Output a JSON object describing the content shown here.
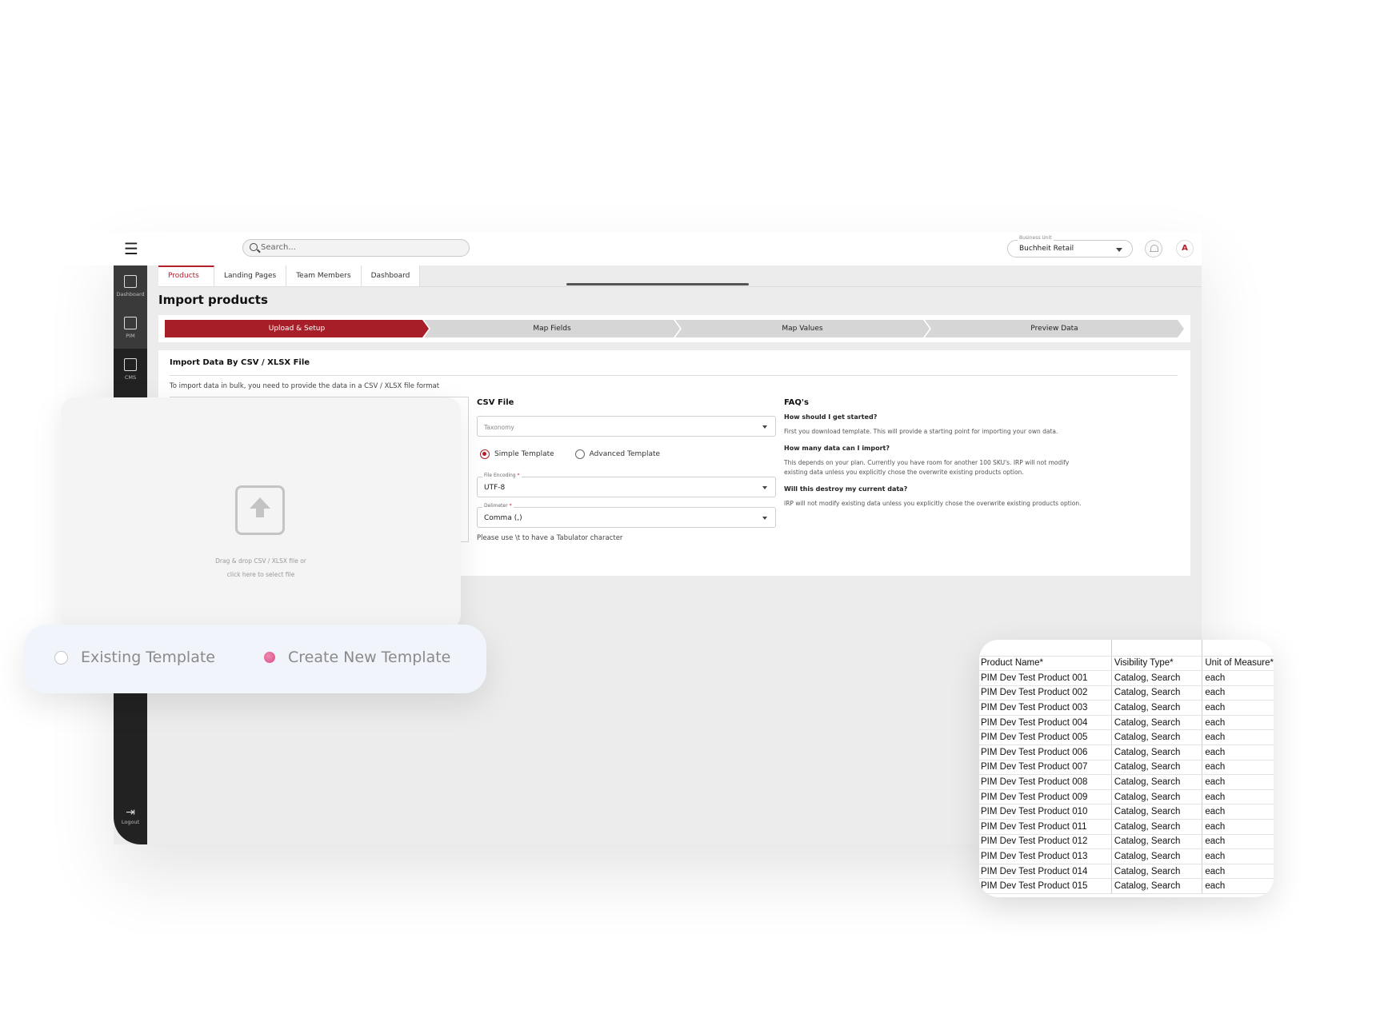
{
  "header": {
    "search_placeholder": "Search...",
    "business_unit_label": "Business Unit",
    "business_unit_value": "Buchheit Retail",
    "avatar_initial": "A"
  },
  "sidebar": {
    "items": [
      {
        "label": "Dashboard",
        "icon": "dashboard-icon"
      },
      {
        "label": "PIM",
        "icon": "pim-icon"
      },
      {
        "label": "CMS",
        "icon": "cms-icon"
      }
    ],
    "logout_label": "Logout"
  },
  "tabs": [
    "Products",
    "Landing Pages",
    "Team Members",
    "Dashboard"
  ],
  "page_title": "Import products",
  "steps": [
    "Upload & Setup",
    "Map Fields",
    "Map Values",
    "Preview Data"
  ],
  "import": {
    "title": "Import Data By CSV / XLSX File",
    "description": "To import data in bulk, you need to provide the data in a CSV / XLSX file format",
    "drop_line1": "Drag & drop CSV / XLSX file or",
    "drop_line2": "click here to select file"
  },
  "csv": {
    "title": "CSV File",
    "taxonomy_placeholder": "Taxonomy",
    "simple_template": "Simple Template",
    "advanced_template": "Advanced Template",
    "encoding_label": "File Encoding",
    "encoding_value": "UTF-8",
    "delimiter_label": "Delimeter",
    "delimiter_value": "Comma (,)",
    "required_mark": "*",
    "hint": "Please use \\t to have a Tabulator character"
  },
  "faq": {
    "title": "FAQ's",
    "items": [
      {
        "q": "How should I get started?",
        "a": "First you download template. This will provide a starting point for importing your own data."
      },
      {
        "q": "How many data can I import?",
        "a": "This depends on your plan. Currently you have room for another 100 SKU's. IRP will not modify existing data unless you explicitly chose the overwrite existing products option."
      },
      {
        "q": "Will this destroy my current data?",
        "a": "IRP will not modify existing data unless you explicitly chose the overwrite existing products option."
      }
    ]
  },
  "template_choice": {
    "existing": "Existing Template",
    "create_new": "Create New Template"
  },
  "sheet": {
    "headers": [
      "Product Name*",
      "Visibility Type*",
      "Unit of Measure*"
    ],
    "rows": [
      [
        "PIM Dev Test Product 001",
        "Catalog, Search",
        "each"
      ],
      [
        "PIM Dev Test Product 002",
        "Catalog, Search",
        "each"
      ],
      [
        "PIM Dev Test Product 003",
        "Catalog, Search",
        "each"
      ],
      [
        "PIM Dev Test Product 004",
        "Catalog, Search",
        "each"
      ],
      [
        "PIM Dev Test Product 005",
        "Catalog, Search",
        "each"
      ],
      [
        "PIM Dev Test Product 006",
        "Catalog, Search",
        "each"
      ],
      [
        "PIM Dev Test Product 007",
        "Catalog, Search",
        "each"
      ],
      [
        "PIM Dev Test Product 008",
        "Catalog, Search",
        "each"
      ],
      [
        "PIM Dev Test Product 009",
        "Catalog, Search",
        "each"
      ],
      [
        "PIM Dev Test Product 010",
        "Catalog, Search",
        "each"
      ],
      [
        "PIM Dev Test Product 011",
        "Catalog, Search",
        "each"
      ],
      [
        "PIM Dev Test Product 012",
        "Catalog, Search",
        "each"
      ],
      [
        "PIM Dev Test Product 013",
        "Catalog, Search",
        "each"
      ],
      [
        "PIM Dev Test Product 014",
        "Catalog, Search",
        "each"
      ],
      [
        "PIM Dev Test Product 015",
        "Catalog, Search",
        "each"
      ]
    ]
  },
  "colors": {
    "accent": "#a81e28",
    "sidebar": "#222222",
    "highlight": "#d94a86"
  }
}
